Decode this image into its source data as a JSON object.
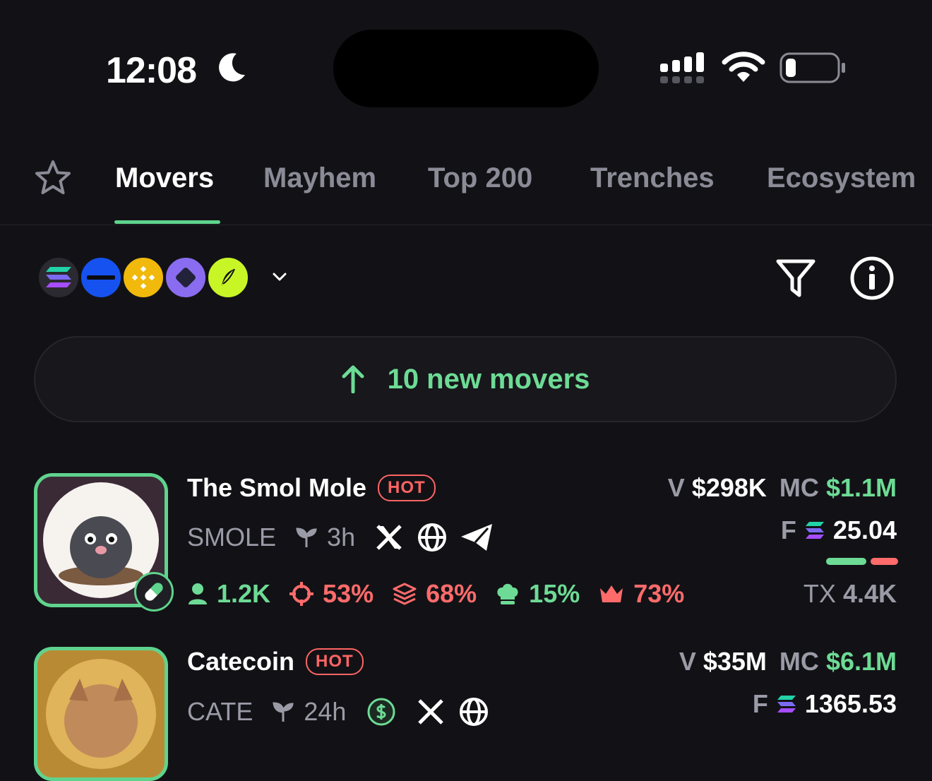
{
  "status_bar": {
    "time": "12:08"
  },
  "tabs": [
    {
      "label": "Movers"
    },
    {
      "label": "Mayhem"
    },
    {
      "label": "Top 200"
    },
    {
      "label": "Trenches"
    },
    {
      "label": "Ecosystem"
    }
  ],
  "banner": {
    "text": "10 new movers"
  },
  "tokens": [
    {
      "name": "The Smol Mole",
      "badge": "HOT",
      "ticker": "SMOLE",
      "age": "3h",
      "volume_label": "V",
      "volume": "$298K",
      "mc_label": "MC",
      "mc": "$1.1M",
      "fees_label": "F",
      "fees": "25.04",
      "tx_label": "TX",
      "tx": "4.4K",
      "holders": "1.2K",
      "snipers": "53%",
      "top_holders": "68%",
      "dev": "15%",
      "insiders": "73%"
    },
    {
      "name": "Catecoin",
      "badge": "HOT",
      "ticker": "CATE",
      "age": "24h",
      "volume_label": "V",
      "volume": "$35M",
      "mc_label": "MC",
      "mc": "$6.1M",
      "fees_label": "F",
      "fees": "1365.53"
    }
  ],
  "colors": {
    "accent_green": "#6ddb95",
    "accent_red": "#ff6b6b",
    "background": "#121216"
  }
}
